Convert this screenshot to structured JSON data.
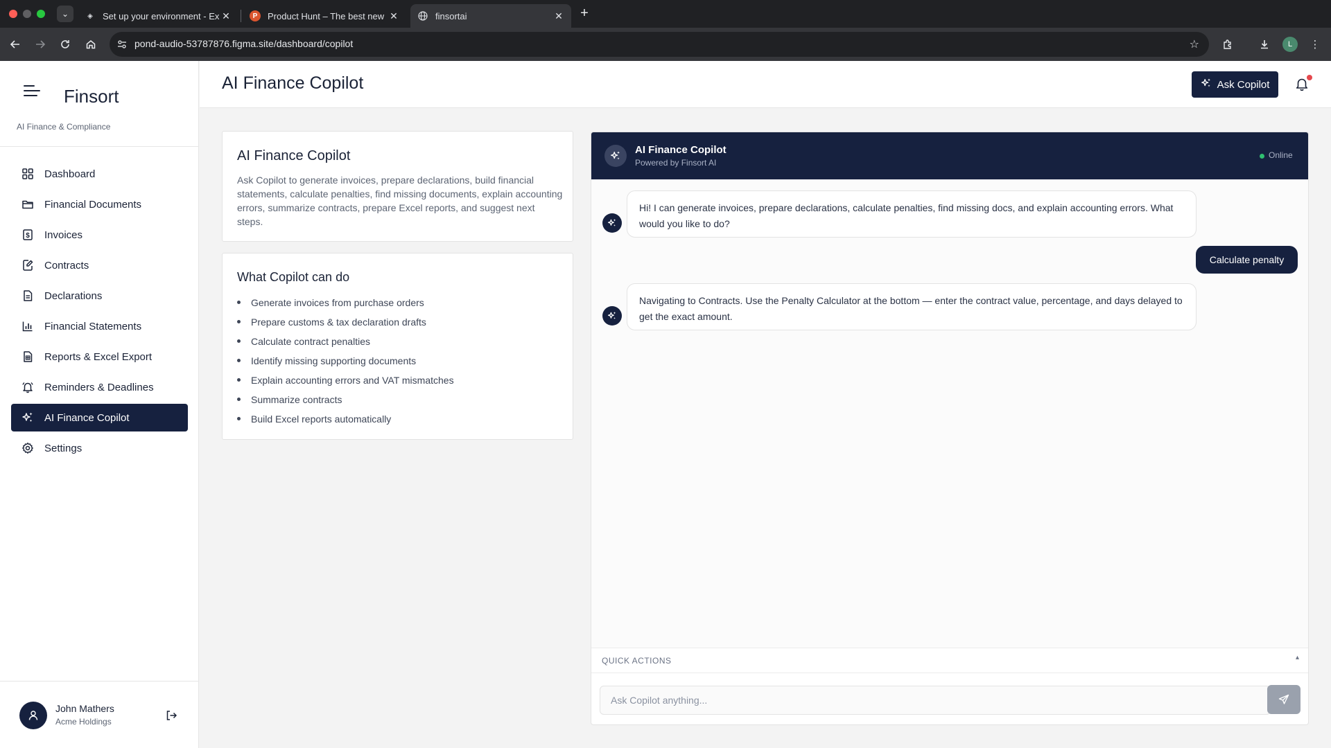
{
  "browser": {
    "tabs": [
      {
        "title": "Set up your environment - Ex",
        "icon": "grid-logo-icon"
      },
      {
        "title": "Product Hunt – The best new",
        "icon": "product-hunt-icon",
        "fav_letter": "P"
      },
      {
        "title": "finsortai",
        "icon": "globe-icon"
      }
    ],
    "url": "pond-audio-53787876.figma.site/dashboard/copilot",
    "profile_initial": "L"
  },
  "sidebar": {
    "brand": "Finsort",
    "subtitle": "AI Finance & Compliance",
    "items": [
      {
        "label": "Dashboard",
        "icon": "dashboard-icon"
      },
      {
        "label": "Financial Documents",
        "icon": "folder-icon"
      },
      {
        "label": "Invoices",
        "icon": "invoice-dollar-icon"
      },
      {
        "label": "Contracts",
        "icon": "contract-edit-icon"
      },
      {
        "label": "Declarations",
        "icon": "document-icon"
      },
      {
        "label": "Financial Statements",
        "icon": "bar-chart-icon"
      },
      {
        "label": "Reports & Excel Export",
        "icon": "spreadsheet-icon"
      },
      {
        "label": "Reminders & Deadlines",
        "icon": "bell-icon"
      },
      {
        "label": "AI Finance Copilot",
        "icon": "sparkles-icon",
        "active": true
      },
      {
        "label": "Settings",
        "icon": "gear-icon"
      }
    ],
    "user": {
      "name": "John Mathers",
      "org": "Acme Holdings"
    }
  },
  "header": {
    "title": "AI Finance Copilot",
    "ask_button": "Ask Copilot"
  },
  "intro_card": {
    "title": "AI Finance Copilot",
    "body": "Ask Copilot to generate invoices, prepare declarations, build financial statements, calculate penalties, find missing documents, explain accounting errors, summarize contracts, prepare Excel reports, and suggest next steps."
  },
  "capabilities_card": {
    "title": "What Copilot can do",
    "items": [
      "Generate invoices from purchase orders",
      "Prepare customs & tax declaration drafts",
      "Calculate contract penalties",
      "Identify missing supporting documents",
      "Explain accounting errors and VAT mismatches",
      "Summarize contracts",
      "Build Excel reports automatically"
    ]
  },
  "chat": {
    "title": "AI Finance Copilot",
    "subtitle": "Powered by Finsort AI",
    "status": "Online",
    "messages": [
      {
        "role": "bot",
        "text": "Hi! I can generate invoices, prepare declarations, calculate penalties, find missing docs, and explain accounting errors. What would you like to do?"
      },
      {
        "role": "user",
        "text": "Calculate penalty"
      },
      {
        "role": "bot",
        "text": "Navigating to Contracts. Use the Penalty Calculator at the bottom — enter the contract value, percentage, and days delayed to get the exact amount."
      }
    ],
    "quick_actions_label": "QUICK ACTIONS",
    "quick_actions_toggle": "▴",
    "input_placeholder": "Ask Copilot anything...",
    "input_value": ""
  },
  "colors": {
    "navy": "#16213f",
    "online": "#2fbf71",
    "notification_dot": "#e5484d"
  }
}
